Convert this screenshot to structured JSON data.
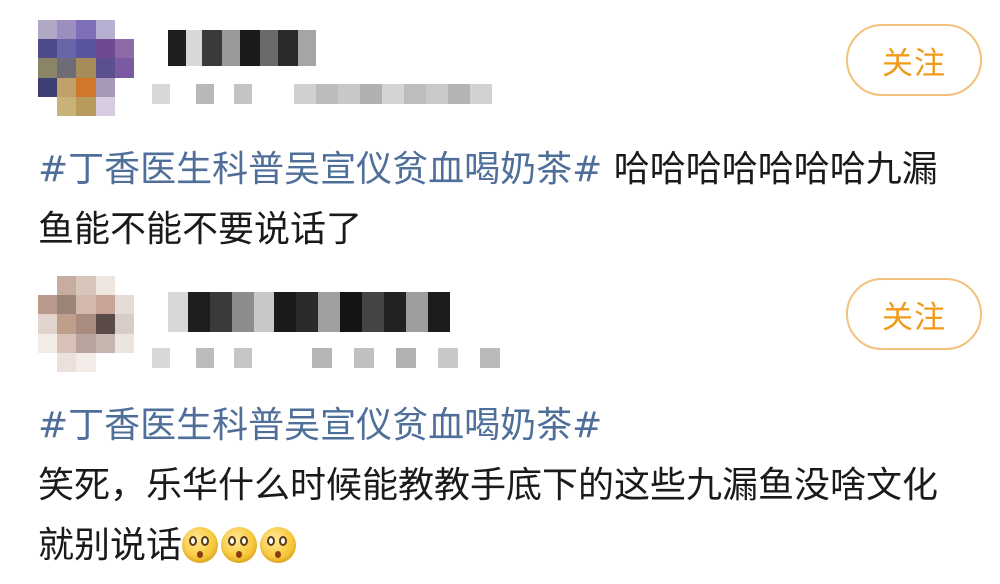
{
  "posts": [
    {
      "follow_label": "关注",
      "hashtag": "#丁香医生科普吴宣仪贫血喝奶茶#",
      "body_line1": " 哈哈哈哈哈哈哈九漏",
      "body_line2": "鱼能不能不要说话了"
    },
    {
      "follow_label": "关注",
      "hashtag": "#丁香医生科普吴宣仪贫血喝奶茶#",
      "body_line1": "笑死，乐华什么时候能教教手底下的这些九漏鱼没啥文化",
      "body_line2": "就别说话"
    }
  ],
  "emojis": [
    "surprised-face-emoji",
    "surprised-face-emoji",
    "surprised-face-emoji"
  ],
  "colors": {
    "hashtag": "#4f6f9a",
    "follow_text": "#f09a1a",
    "follow_border": "#f2c27a",
    "text": "#1a1a1a"
  }
}
